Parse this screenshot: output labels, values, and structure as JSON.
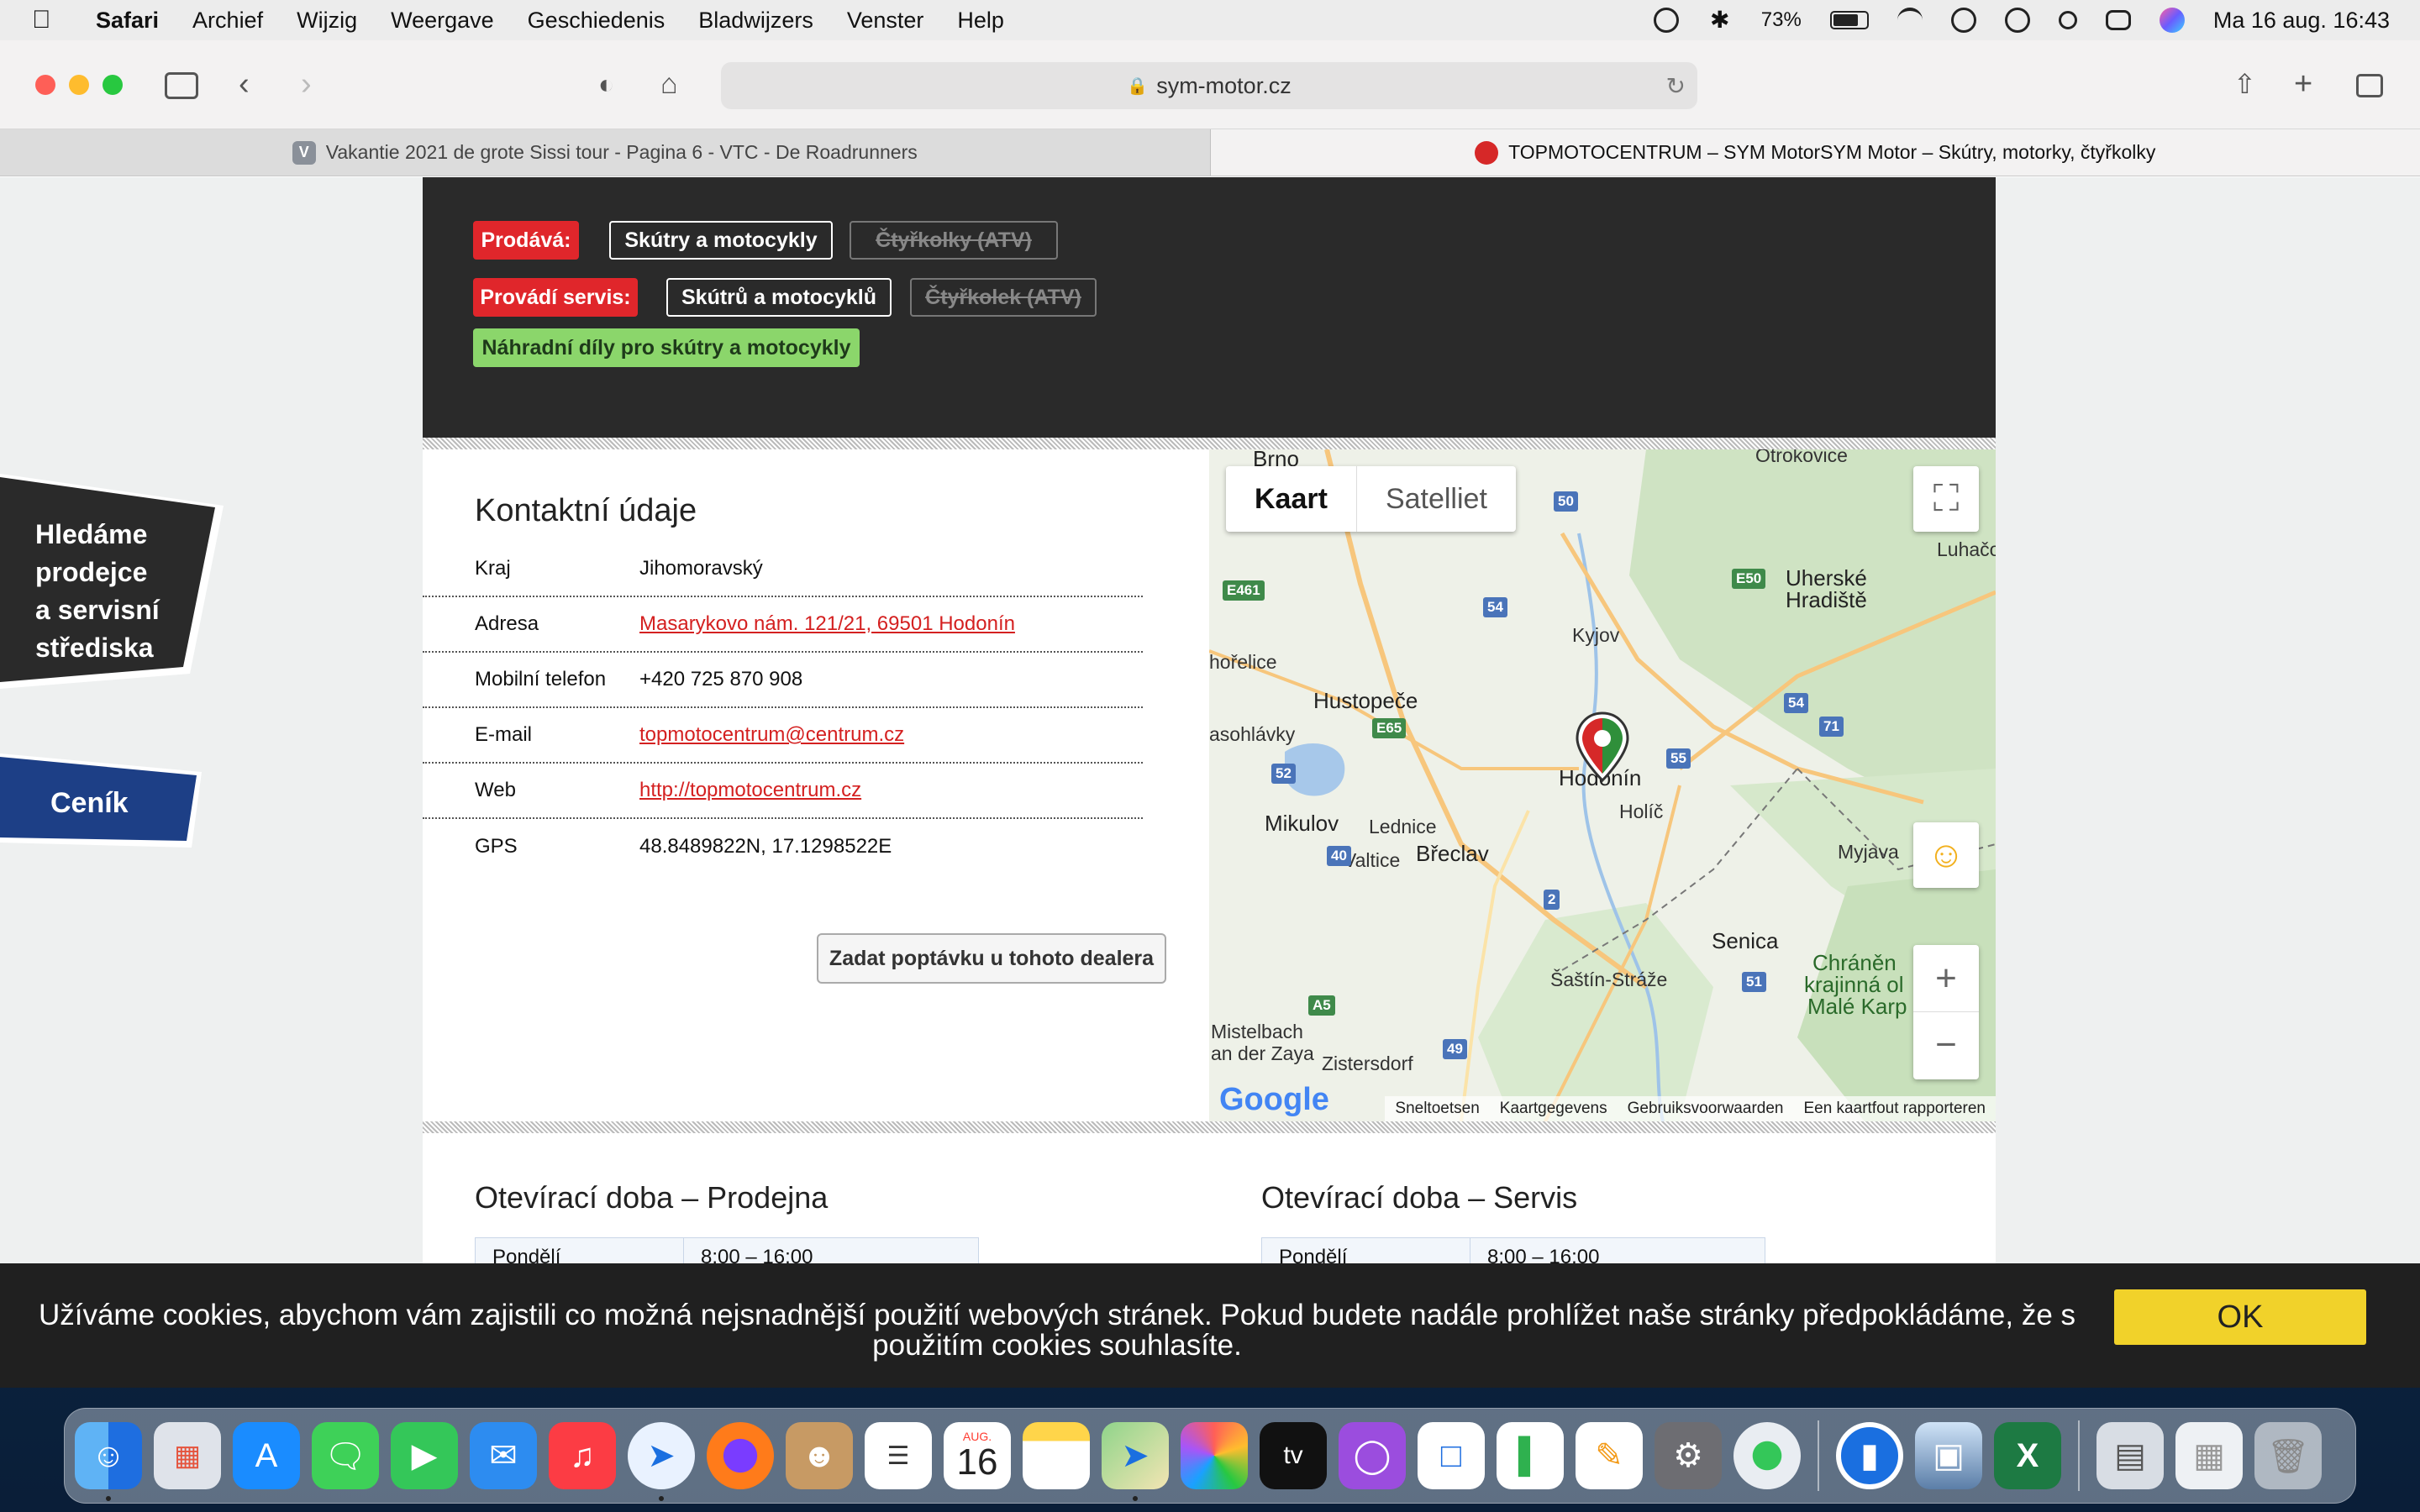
{
  "menubar": {
    "app": "Safari",
    "items": [
      "Archief",
      "Wijzig",
      "Weergave",
      "Geschiedenis",
      "Bladwijzers",
      "Venster",
      "Help"
    ],
    "battery_percent": "73%",
    "datetime": "Ma 16 aug.  16:43"
  },
  "browser": {
    "url": "sym-motor.cz",
    "tabs": [
      {
        "label": "Vakantie 2021 de grote Sissi tour - Pagina 6 - VTC - De Roadrunners",
        "favicon": "V",
        "active": false
      },
      {
        "label": "TOPMOTOCENTRUM – SYM MotorSYM Motor – Skútry, motorky, čtyřkolky",
        "favicon": "S",
        "active": true
      }
    ]
  },
  "dealer_tags": {
    "sells_label": "Prodává:",
    "sells": [
      {
        "label": "Skútry a motocykly",
        "enabled": true
      },
      {
        "label": "Čtyřkolky (ATV)",
        "enabled": false
      }
    ],
    "service_label": "Provádí servis:",
    "service": [
      {
        "label": "Skútrů a motocyklů",
        "enabled": true
      },
      {
        "label": "Čtyřkolek (ATV)",
        "enabled": false
      }
    ],
    "parts": "Náhradní díly pro skútry a motocykly"
  },
  "contact": {
    "title": "Kontaktní údaje",
    "rows": [
      {
        "key": "Kraj",
        "value": "Jihomoravský",
        "link": false
      },
      {
        "key": "Adresa",
        "value": "Masarykovo nám. 121/21, 69501 Hodonín",
        "link": true
      },
      {
        "key": "Mobilní telefon",
        "value": "+420 725 870 908",
        "link": false
      },
      {
        "key": "E-mail",
        "value": "topmotocentrum@centrum.cz",
        "link": true
      },
      {
        "key": "Web",
        "value": "http://topmotocentrum.cz",
        "link": true
      },
      {
        "key": "GPS",
        "value": "48.8489822N, 17.1298522E",
        "link": false
      }
    ],
    "inquiry_button": "Zadat poptávku u tohoto dealera"
  },
  "map": {
    "type_options": [
      "Kaart",
      "Satelliet"
    ],
    "selected_type": "Kaart",
    "zoom_in": "+",
    "zoom_out": "−",
    "places": [
      "Brno",
      "Uherské",
      "Hradiště",
      "Luhačo",
      "Kyjov",
      "Hustopeče",
      "hořelice",
      "asohlávky",
      "Hodonín",
      "Holíč",
      "Mikulov",
      "Lednice",
      "Valtice",
      "Břeclav",
      "Myjava",
      "Senica",
      "Šaštín-Stráže",
      "Mistelbach",
      "an der Zaya",
      "Zistersdorf",
      "Chráněn",
      "krajinná ol",
      "Malé Karp",
      "Otrokovice"
    ],
    "roads": [
      "50",
      "E461",
      "54",
      "E50",
      "E65",
      "52",
      "54",
      "71",
      "55",
      "40",
      "2",
      "A5",
      "51",
      "49"
    ],
    "footer_links": [
      "Sneltoetsen",
      "Kaartgegevens",
      "Gebruiksvoorwaarden",
      "Een kaartfout rapporteren"
    ],
    "logo": "Google"
  },
  "hours": {
    "shop_title": "Otevírací doba – Prodejna",
    "service_title": "Otevírací doba – Servis",
    "shop_first_day": "Pondělí",
    "shop_first_time": "8:00 – 16:00",
    "service_first_day": "Pondělí",
    "service_first_time": "8:00 – 16:00"
  },
  "side_badges": {
    "dealers": [
      "Hledáme",
      "prodejce",
      "a servisní",
      "střediska"
    ],
    "price": "Ceník"
  },
  "cookie": {
    "message": "Užíváme cookies, abychom vám zajistili co možná nejsnadnější použití webových stránek. Pokud budete nadále prohlížet naše stránky předpokládáme, že s použitím cookies souhlasíte.",
    "ok": "OK"
  },
  "dock": {
    "calendar_month": "AUG.",
    "calendar_day": "16",
    "apps": [
      "finder",
      "launchpad",
      "app-store",
      "messages",
      "facetime",
      "mail",
      "music",
      "safari",
      "firefox",
      "contacts",
      "reminders",
      "calendar",
      "notes",
      "maps",
      "photos",
      "apple-tv",
      "podcasts",
      "keynote",
      "numbers",
      "pages",
      "system-preferences",
      "find-my",
      "1password",
      "preview",
      "excel",
      "downloads",
      "trash"
    ]
  }
}
